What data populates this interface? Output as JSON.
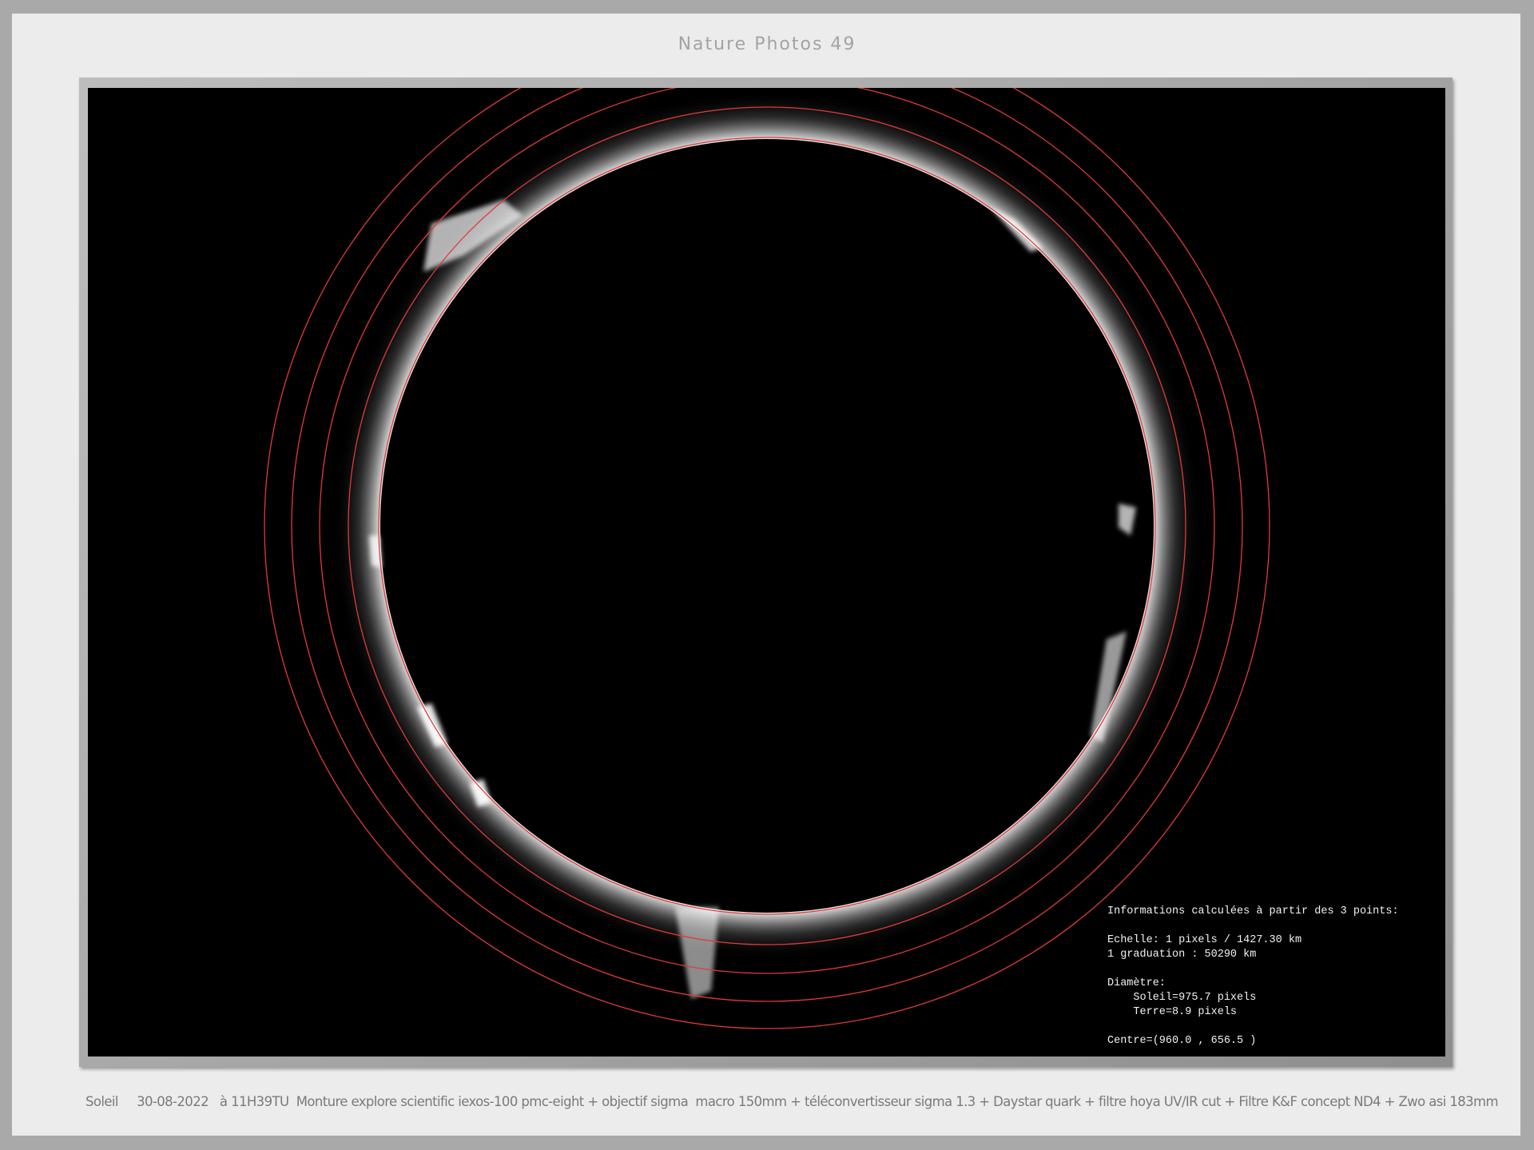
{
  "title": "Nature Photos 49",
  "photo": {
    "subject": "Soleil",
    "overlay_color": "#e03a3a",
    "info": {
      "heading": "Informations calculées à partir des 3 points:",
      "scale": "Echelle: 1 pixels / 1427.30 km",
      "graduation": "1 graduation : 50290 km",
      "diameter_label": "Diamètre:",
      "sun_diameter": "    Soleil=975.7 pixels",
      "earth_diameter": "    Terre=8.9 pixels",
      "centre": "Centre=(960.0 , 656.5 )"
    }
  },
  "caption": "Soleil     30-08-2022   à 11H39TU  Monture explore scientific iexos-100 pmc-eight + objectif sigma  macro 150mm + téléconvertisseur sigma 1.3 + Daystar quark + filtre hoya UV/IR cut + Filtre K&F concept ND4 + Zwo asi 183mm"
}
